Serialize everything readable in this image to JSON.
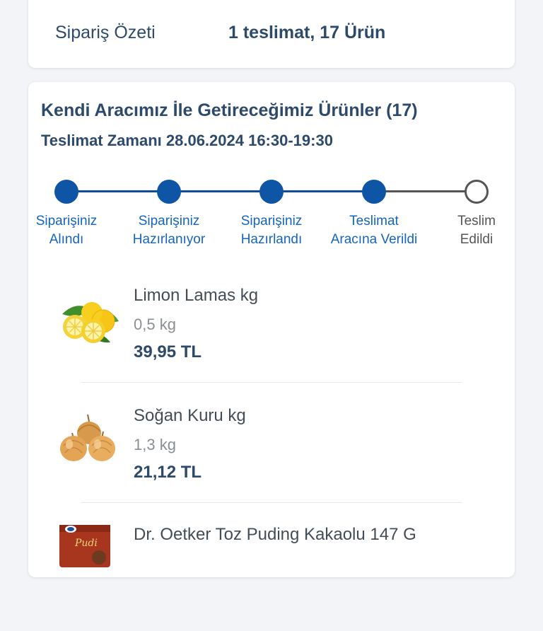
{
  "summary": {
    "label": "Sipariş Özeti",
    "value": "1 teslimat, 17 Ürün"
  },
  "delivery": {
    "title": "Kendi Aracımız İle Getireceğimiz Ürünler (17)",
    "time": "Teslimat Zamanı 28.06.2024 16:30-19:30",
    "steps": [
      {
        "line1": "Siparişiniz",
        "line2": "Alındı",
        "status": "done"
      },
      {
        "line1": "Siparişiniz",
        "line2": "Hazırlanıyor",
        "status": "done"
      },
      {
        "line1": "Siparişiniz",
        "line2": "Hazırlandı",
        "status": "done"
      },
      {
        "line1": "Teslimat",
        "line2": "Aracına Verildi",
        "status": "done"
      },
      {
        "line1": "Teslim",
        "line2": "Edildi",
        "status": "pending"
      }
    ],
    "colors": {
      "active": "#0f55a5",
      "inactive": "#555555"
    }
  },
  "products": [
    {
      "name": "Limon Lamas kg",
      "qty": "0,5 kg",
      "price": "39,95 TL",
      "icon": "lemon-icon"
    },
    {
      "name": "Soğan Kuru kg",
      "qty": "1,3 kg",
      "price": "21,12 TL",
      "icon": "onion-icon"
    },
    {
      "name": "Dr. Oetker Toz Puding Kakaolu 147 G",
      "qty": "",
      "price": "",
      "icon": "pudding-package-icon"
    }
  ]
}
